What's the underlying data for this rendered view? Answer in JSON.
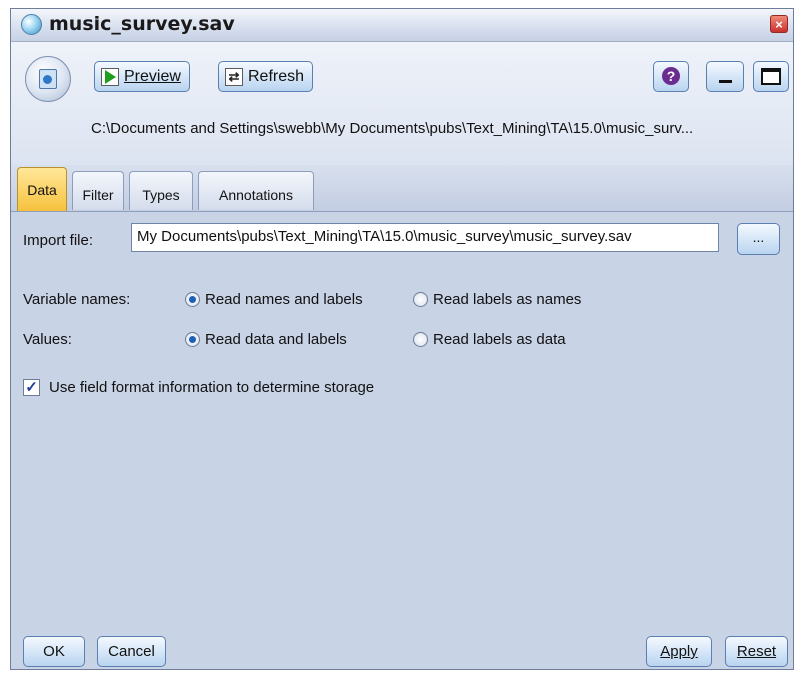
{
  "window": {
    "title": "music_survey.sav",
    "close_glyph": "×"
  },
  "toolbar": {
    "preview_label": "Preview",
    "refresh_label": "Refresh",
    "help_glyph": "?"
  },
  "header": {
    "path": "C:\\Documents and Settings\\swebb\\My Documents\\pubs\\Text_Mining\\TA\\15.0\\music_surv..."
  },
  "tabs": [
    {
      "label": "Data",
      "active": true
    },
    {
      "label": "Filter",
      "active": false
    },
    {
      "label": "Types",
      "active": false
    },
    {
      "label": "Annotations",
      "active": false
    }
  ],
  "data_tab": {
    "import_file_label": "Import file:",
    "import_file_value": "My Documents\\pubs\\Text_Mining\\TA\\15.0\\music_survey\\music_survey.sav",
    "browse_label": "...",
    "variable_names_label": "Variable names:",
    "variable_names_options": [
      "Read names and labels",
      "Read labels as names"
    ],
    "variable_names_selected": "Read names and labels",
    "values_label": "Values:",
    "values_options": [
      "Read data and labels",
      "Read labels as data"
    ],
    "values_selected": "Read data and labels",
    "use_field_format_label": "Use field format information to determine storage",
    "use_field_format_checked": true
  },
  "footer": {
    "ok_label": "OK",
    "cancel_label": "Cancel",
    "apply_label": "Apply",
    "reset_label": "Reset"
  },
  "colors": {
    "window_bg": "#c9d3e6",
    "active_tab": "#f6c23c",
    "button_border": "#5a7fb0"
  }
}
